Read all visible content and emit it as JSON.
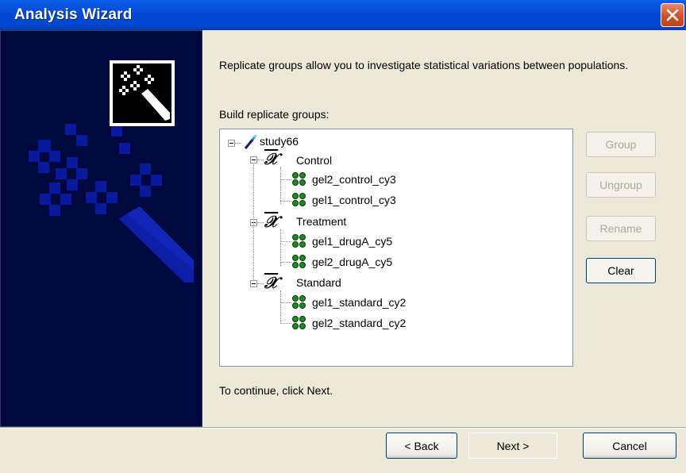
{
  "window": {
    "title": "Analysis Wizard"
  },
  "content": {
    "intro": "Replicate groups allow you to investigate statistical variations between populations.",
    "build_label": "Build replicate groups:",
    "continue_label": "To continue, click Next."
  },
  "tree": {
    "root": "study66",
    "groups": [
      {
        "label": "Control",
        "items": [
          "gel2_control_cy3",
          "gel1_control_cy3"
        ]
      },
      {
        "label": "Treatment",
        "items": [
          "gel1_drugA_cy5",
          "gel2_drugA_cy5"
        ]
      },
      {
        "label": "Standard",
        "items": [
          "gel1_standard_cy2",
          "gel2_standard_cy2"
        ]
      }
    ]
  },
  "side_buttons": {
    "group": "Group",
    "ungroup": "Ungroup",
    "rename": "Rename",
    "clear": "Clear"
  },
  "footer": {
    "back": "< Back",
    "next": "Next >",
    "cancel": "Cancel"
  },
  "colors": {
    "titlebar": "#0149d4",
    "sidebar": "#000840",
    "pixel_art": "#0a1a9c",
    "group_icon_green": "#1f8a1f"
  }
}
